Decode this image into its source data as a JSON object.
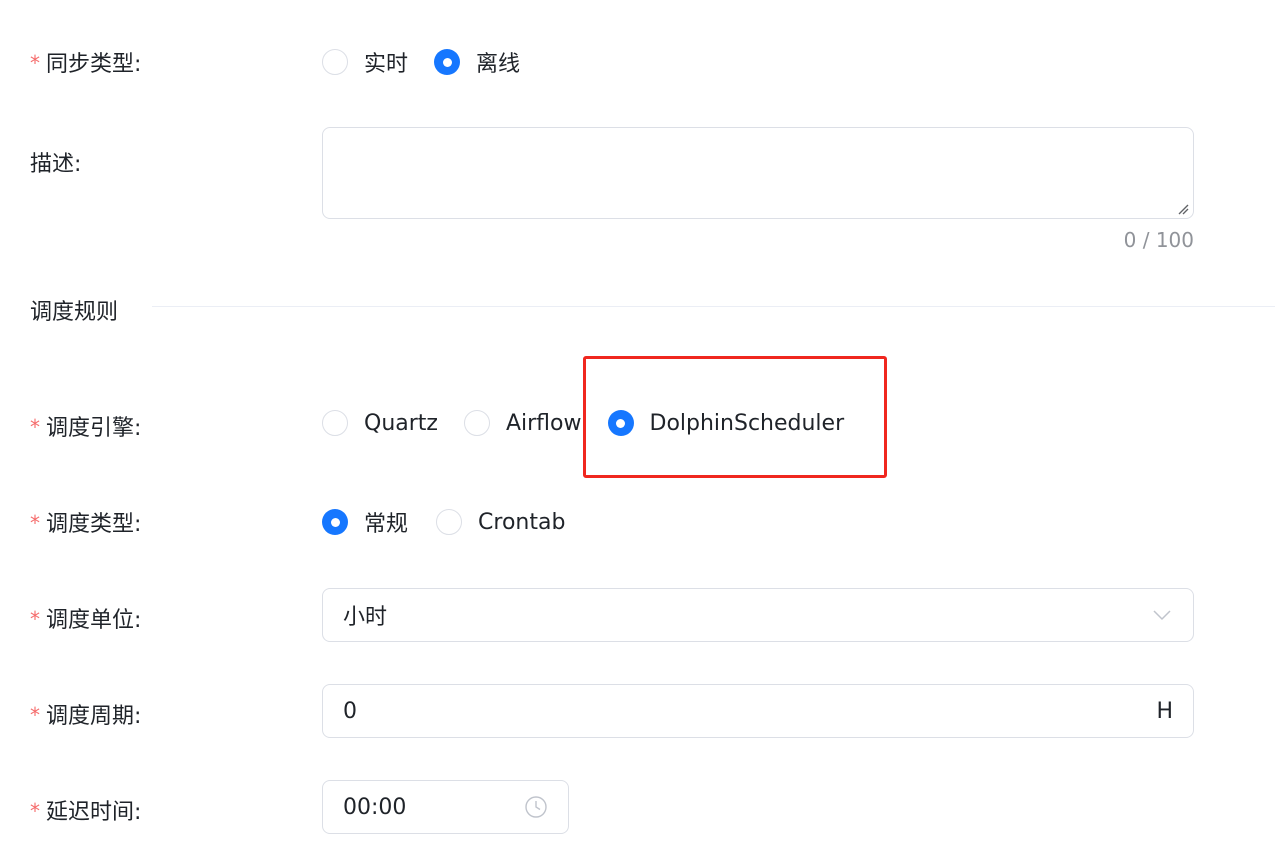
{
  "required_mark": "*",
  "sync_type": {
    "label": "同步类型:",
    "options": [
      {
        "label": "实时",
        "checked": false
      },
      {
        "label": "离线",
        "checked": true
      }
    ]
  },
  "description": {
    "label": "描述:",
    "value": "",
    "counter": "0 / 100"
  },
  "schedule_section": {
    "title": "调度规则"
  },
  "schedule_engine": {
    "label": "调度引擎:",
    "options": [
      {
        "label": "Quartz",
        "checked": false
      },
      {
        "label": "Airflow",
        "checked": false
      },
      {
        "label": "DolphinScheduler",
        "checked": true
      }
    ]
  },
  "schedule_type": {
    "label": "调度类型:",
    "options": [
      {
        "label": "常规",
        "checked": true
      },
      {
        "label": "Crontab",
        "checked": false
      }
    ]
  },
  "schedule_unit": {
    "label": "调度单位:",
    "value": "小时"
  },
  "schedule_period": {
    "label": "调度周期:",
    "value": "0",
    "suffix": "H"
  },
  "delay_time": {
    "label": "延迟时间:",
    "value": "00:00"
  },
  "colors": {
    "primary": "#1677ff",
    "required": "#f56c6c",
    "highlight": "#f0271f",
    "border": "#dcdfe6"
  }
}
